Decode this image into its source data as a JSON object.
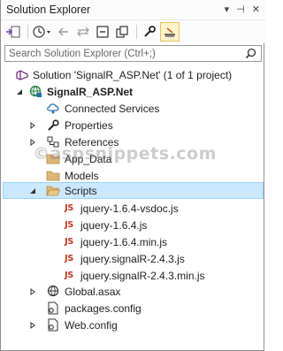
{
  "window": {
    "title": "Solution Explorer"
  },
  "search": {
    "placeholder": "Search Solution Explorer (Ctrl+;)",
    "value": ""
  },
  "watermark": {
    "text": "©aspsnippets.com"
  },
  "tree": {
    "solution_label": "Solution 'SignalR_ASP.Net' (1 of 1 project)",
    "project_label": "SignalR_ASP.Net",
    "connected_services": "Connected Services",
    "properties": "Properties",
    "references": "References",
    "app_data": "App_Data",
    "models": "Models",
    "scripts": "Scripts",
    "files": [
      "jquery-1.6.4-vsdoc.js",
      "jquery-1.6.4.js",
      "jquery-1.6.4.min.js",
      "jquery.signalR-2.4.3.js",
      "jquery.signalR-2.4.3.min.js"
    ],
    "global_asax": "Global.asax",
    "packages_config": "packages.config",
    "web_config": "Web.config",
    "js_badge": "JS"
  },
  "colors": {
    "selection_bg": "#cce8ff",
    "selection_border": "#99d1ff",
    "js_icon": "#c4361c",
    "folder": "#dcb67a",
    "active_tool": "#fff3c8"
  }
}
